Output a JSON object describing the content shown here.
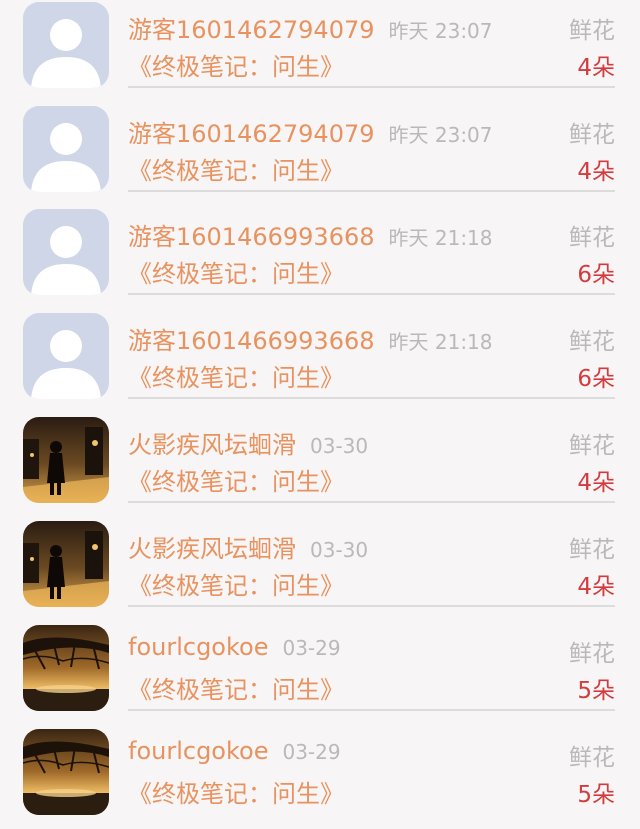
{
  "entries": [
    {
      "name": "游客1601462794079",
      "time": "昨天 23:07",
      "gift_label": "鲜花",
      "book": "《终极笔记：问生》",
      "count": "4朵",
      "avatar": "default-user-avatar"
    },
    {
      "name": "游客1601462794079",
      "time": "昨天 23:07",
      "gift_label": "鲜花",
      "book": "《终极笔记：问生》",
      "count": "4朵",
      "avatar": "default-user-avatar"
    },
    {
      "name": "游客1601466993668",
      "time": "昨天 21:18",
      "gift_label": "鲜花",
      "book": "《终极笔记：问生》",
      "count": "6朵",
      "avatar": "default-user-avatar"
    },
    {
      "name": "游客1601466993668",
      "time": "昨天 21:18",
      "gift_label": "鲜花",
      "book": "《终极笔记：问生》",
      "count": "6朵",
      "avatar": "default-user-avatar"
    },
    {
      "name": "火影疾风坛蛔滑",
      "time": "03-30",
      "gift_label": "鲜花",
      "book": "《终极笔记：问生》",
      "count": "4朵",
      "avatar": "street-photo-avatar"
    },
    {
      "name": "火影疾风坛蛔滑",
      "time": "03-30",
      "gift_label": "鲜花",
      "book": "《终极笔记：问生》",
      "count": "4朵",
      "avatar": "street-photo-avatar"
    },
    {
      "name": "fourlcgokoe",
      "time": "03-29",
      "gift_label": "鲜花",
      "book": "《终极笔记：问生》",
      "count": "5朵",
      "avatar": "tree-sunset-avatar"
    },
    {
      "name": "fourlcgokoe",
      "time": "03-29",
      "gift_label": "鲜花",
      "book": "《终极笔记：问生》",
      "count": "5朵",
      "avatar": "tree-sunset-avatar"
    }
  ],
  "colors": {
    "name": "#e8935f",
    "time": "#b9b9b9",
    "count": "#d43b3e",
    "divider": "#dcdcdc",
    "background": "#f7f5f5"
  }
}
